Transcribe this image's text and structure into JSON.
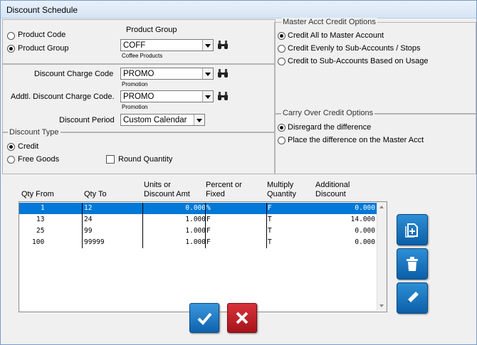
{
  "window": {
    "title": "Discount Schedule"
  },
  "product_selector": {
    "product_code_label": "Product Code",
    "product_group_label": "Product Group",
    "selected": "product_group"
  },
  "product_group": {
    "heading": "Product Group",
    "value": "COFF",
    "description": "Coffee Products"
  },
  "discount_charge": {
    "label": "Discount Charge Code",
    "value": "PROMO",
    "description": "Promotion"
  },
  "addtl_discount_charge": {
    "label": "Addtl. Discount Charge Code.",
    "value": "PROMO",
    "description": "Promotion"
  },
  "discount_period": {
    "label": "Discount Period",
    "value": "Custom Calendar"
  },
  "discount_type": {
    "legend": "Discount Type",
    "credit_label": "Credit",
    "free_goods_label": "Free Goods",
    "round_quantity_label": "Round Quantity",
    "selected": "credit",
    "round_quantity_checked": false
  },
  "master_acct_credit": {
    "legend": "Master Acct Credit Options",
    "options": [
      {
        "label": "Credit All to Master Account",
        "selected": true
      },
      {
        "label": "Credit Evenly to Sub-Accounts / Stops",
        "selected": false
      },
      {
        "label": "Credit to Sub-Accounts Based on Usage",
        "selected": false
      }
    ]
  },
  "carry_over_credit": {
    "legend": "Carry Over Credit Options",
    "options": [
      {
        "label": "Disregard the difference",
        "selected": true
      },
      {
        "label": "Place the difference on the Master Acct",
        "selected": false
      }
    ]
  },
  "table": {
    "headers": {
      "qty_from": "Qty From",
      "qty_to": "Qty To",
      "units_line1": "Units or",
      "units_line2": "Discount Amt",
      "percent_line1": "Percent or",
      "percent_line2": "Fixed",
      "multiply_line1": "Multiply",
      "multiply_line2": "Quantity",
      "additional_line1": "Additional",
      "additional_line2": "Discount"
    },
    "rows": [
      {
        "qty_from": "1",
        "qty_to": "12",
        "units": "0.000",
        "pct_fixed": "%",
        "multiply": "F",
        "additional": "0.000"
      },
      {
        "qty_from": "13",
        "qty_to": "24",
        "units": "1.000",
        "pct_fixed": "F",
        "multiply": "T",
        "additional": "14.000"
      },
      {
        "qty_from": "25",
        "qty_to": "99",
        "units": "1.000",
        "pct_fixed": "F",
        "multiply": "T",
        "additional": "0.000"
      },
      {
        "qty_from": "100",
        "qty_to": "99999",
        "units": "1.000",
        "pct_fixed": "F",
        "multiply": "T",
        "additional": "0.000"
      }
    ],
    "selected_row": 0
  },
  "icons": {
    "lookup": "binoculars-icon",
    "add": "add-document-icon",
    "delete": "trash-icon",
    "edit": "pencil-icon",
    "ok": "checkmark-icon",
    "cancel": "x-icon"
  },
  "colors": {
    "accent": "#0078d7",
    "ok": "#1a6fbf",
    "cancel": "#c0232a"
  }
}
